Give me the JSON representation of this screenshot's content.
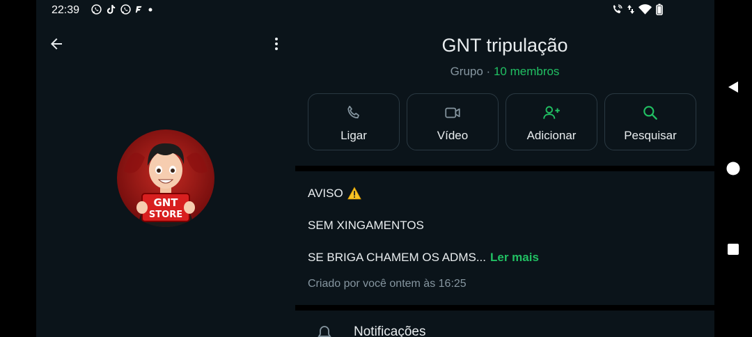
{
  "status_bar": {
    "time": "22:39",
    "notification_icons": [
      "whatsapp-icon",
      "tiktok-icon",
      "whatsapp-icon",
      "flash-icon",
      "dot-icon"
    ],
    "system_icons": [
      "call-wifi-icon",
      "data-arrows-icon",
      "wifi-icon",
      "battery-icon"
    ]
  },
  "header": {
    "back_icon": "arrow-left-icon",
    "more_icon": "more-vertical-icon"
  },
  "avatar": {
    "label_line1": "GNT",
    "label_line2": "STORE"
  },
  "group": {
    "title": "GNT tripulação",
    "type": "Grupo",
    "separator": "·",
    "members": "10 membros"
  },
  "actions": [
    {
      "label": "Ligar",
      "icon": "phone-icon"
    },
    {
      "label": "Vídeo",
      "icon": "video-icon"
    },
    {
      "label": "Adicionar",
      "icon": "add-person-icon"
    },
    {
      "label": "Pesquisar",
      "icon": "search-icon"
    }
  ],
  "description": {
    "line1": "AVISO",
    "line1_emoji": "⚠️",
    "line2": "SEM XINGAMENTOS",
    "line3": "SE BRIGA CHAMEM OS ADMS...",
    "read_more": "Ler mais",
    "created": "Criado por você ontem às 16:25"
  },
  "notifications": {
    "label": "Notificações",
    "icon": "bell-icon"
  },
  "navbar": {
    "icons": [
      "back-triangle-icon",
      "home-circle-icon",
      "recents-square-icon"
    ]
  },
  "colors": {
    "background": "#0b141a",
    "accent": "#21c063",
    "secondary_text": "#8696a0",
    "border": "#2a3942"
  }
}
